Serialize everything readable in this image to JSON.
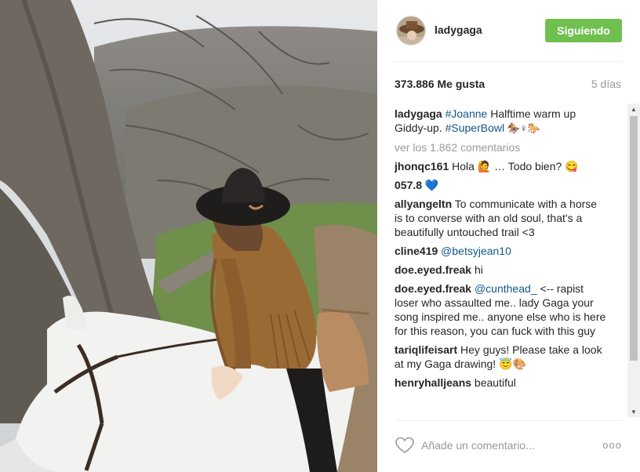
{
  "post": {
    "username": "ladygaga",
    "follow_label": "Siguiendo",
    "likes": "373.886 Me gusta",
    "age": "5 días"
  },
  "caption": {
    "user": "ladygaga",
    "hashtag1": "#Joanne",
    "text1": " Halftime warm up Giddy-up. ",
    "hashtag2": "#SuperBowl",
    "emoji": " 🏇♀🐎"
  },
  "view_all": "ver los 1.862 comentarios",
  "comments": [
    {
      "user": "jhonqc161",
      "text": " Hola 🙋 … Todo bien? 😋"
    },
    {
      "user": "057.8",
      "text": " 💙"
    },
    {
      "user": "allyangeltn",
      "text": " To communicate with a horse is to converse with an old soul, that's a beautifully untouched trail <3"
    },
    {
      "user": "cline419",
      "mention": " @betsyjean10",
      "text": ""
    },
    {
      "user": "doe.eyed.freak",
      "text": " hi"
    },
    {
      "user": "doe.eyed.freak",
      "mention": " @cunthead_",
      "text": " <-- rapist loser who assaulted me.. lady Gaga your song inspired me.. anyone else who is here for this reason, you can fuck with this guy"
    },
    {
      "user": "tariqlifeisart",
      "text": " Hey guys! Please take a look at my Gaga drawing! 😇🎨"
    },
    {
      "user": "henryhalljeans",
      "text": " beautiful"
    }
  ],
  "footer": {
    "placeholder": "Añade un comentario...",
    "more": "ooo"
  },
  "icons": {
    "like": "heart-outline-icon",
    "more": "more-options-icon",
    "avatar": "profile-avatar"
  },
  "colors": {
    "follow_button": "#70c050",
    "hashtag": "#125688",
    "muted": "#999999"
  }
}
